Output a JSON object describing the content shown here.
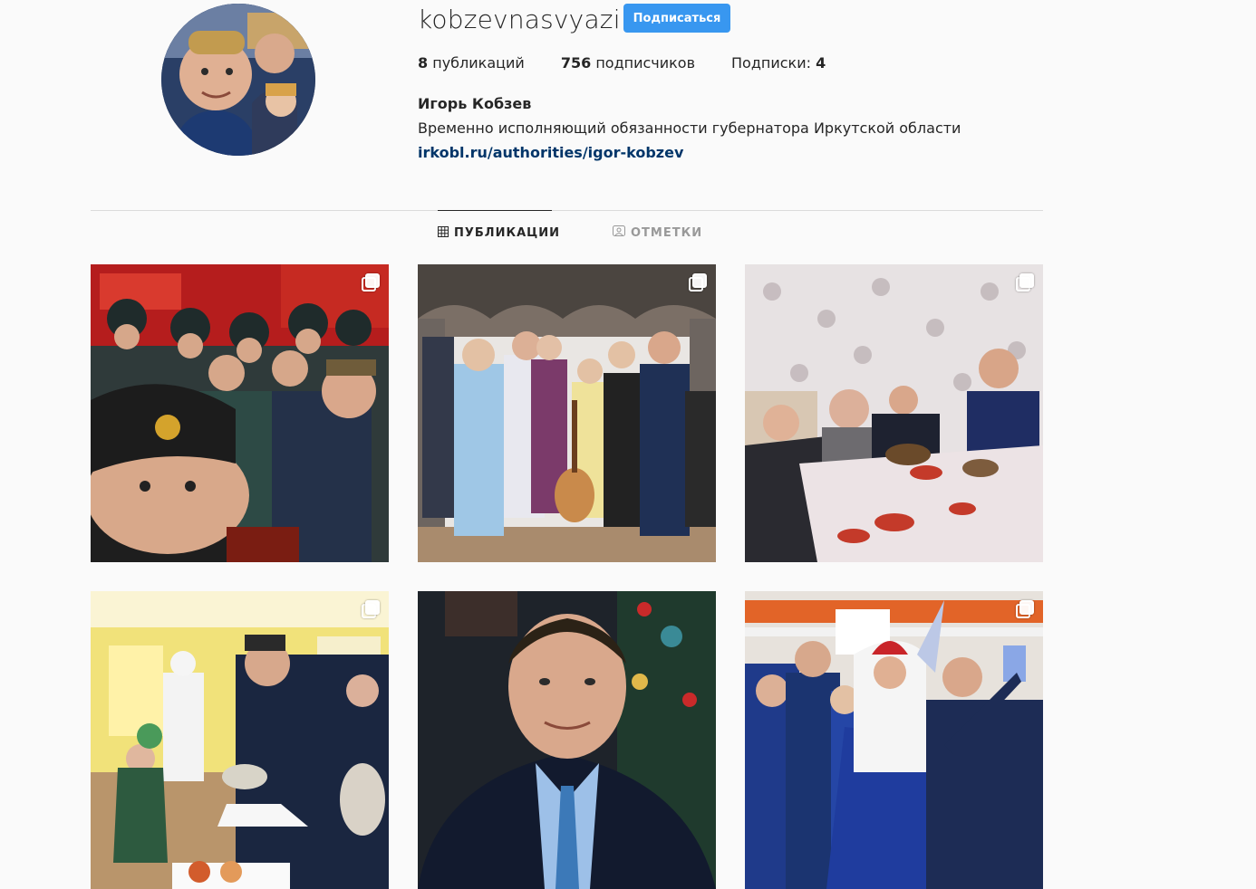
{
  "profile": {
    "username": "kobzevnasvyazi",
    "follow_label": "Подписаться",
    "stats": {
      "posts_count": "8",
      "posts_label": "публикаций",
      "followers_count": "756",
      "followers_label": "подписчиков",
      "following_label": "Подписки:",
      "following_count": "4"
    },
    "full_name": "Игорь Кобзев",
    "bio": "Временно исполняющий обязанности губернатора Иркутской области",
    "link": "irkobl.ru/authorities/igor-kobzev"
  },
  "tabs": {
    "posts_label": "ПУБЛИКАЦИИ",
    "tagged_label": "ОТМЕТКИ",
    "active": "posts"
  },
  "grid": {
    "posts": [
      {
        "subject": "fire-station-selfie-with-firefighters",
        "multi": true
      },
      {
        "subject": "family-with-ded-moroz-and-snegurochka-guitar",
        "multi": true
      },
      {
        "subject": "family-dinner-table",
        "multi": true
      },
      {
        "subject": "school-dining-hall-gifts",
        "multi": true
      },
      {
        "subject": "official-portrait-christmas-tree",
        "multi": false
      },
      {
        "subject": "family-selfie-with-ded-moroz",
        "multi": true
      }
    ]
  },
  "icons": {
    "posts_tab": "grid-icon",
    "tagged_tab": "tagged-icon",
    "multi_post": "multiple-photos-icon"
  },
  "colors": {
    "background": "#fafafa",
    "follow_button": "#3897f0",
    "link": "#003569",
    "divider": "#dbdbdb"
  }
}
